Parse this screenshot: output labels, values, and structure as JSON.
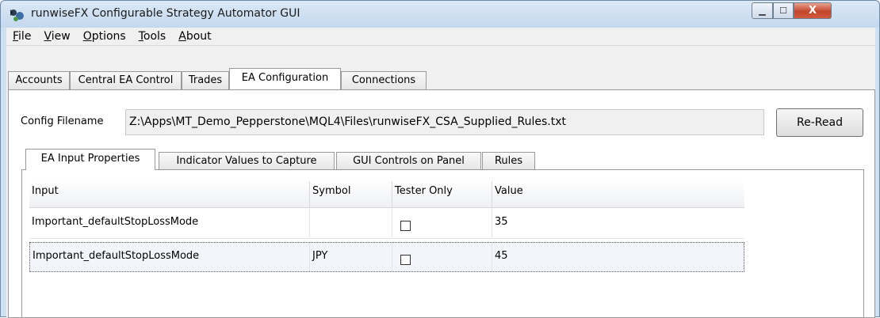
{
  "window": {
    "title": "runwiseFX Configurable Strategy Automator GUI",
    "controls": {
      "minimize": "▁",
      "maximize": "☐",
      "close": "X"
    }
  },
  "menu": [
    {
      "label": "File",
      "accel": "F",
      "rest": "ile"
    },
    {
      "label": "View",
      "accel": "V",
      "rest": "iew"
    },
    {
      "label": "Options",
      "accel": "O",
      "rest": "ptions"
    },
    {
      "label": "Tools",
      "accel": "T",
      "rest": "ools"
    },
    {
      "label": "About",
      "accel": "A",
      "rest": "bout"
    }
  ],
  "top_tabs": [
    {
      "label": "Accounts"
    },
    {
      "label": "Central EA Control"
    },
    {
      "label": "Trades"
    },
    {
      "label": "EA Configuration",
      "active": true
    },
    {
      "label": "Connections"
    }
  ],
  "config": {
    "label": "Config Filename",
    "value": "Z:\\Apps\\MT_Demo_Pepperstone\\MQL4\\Files\\runwiseFX_CSA_Supplied_Rules.txt",
    "reread_label": "Re-Read"
  },
  "inner_tabs": [
    {
      "label": "EA Input Properties",
      "active": true
    },
    {
      "label": "Indicator Values to Capture"
    },
    {
      "label": "GUI Controls on Panel"
    },
    {
      "label": "Rules"
    }
  ],
  "grid": {
    "columns": [
      "Input",
      "Symbol",
      "Tester Only",
      "Value"
    ],
    "rows": [
      {
        "input": "Important_defaultStopLossMode",
        "symbol": "",
        "tester_only": false,
        "value": "35"
      },
      {
        "input": "Important_defaultStopLossMode",
        "symbol": "JPY",
        "tester_only": false,
        "value": "45",
        "selected": true
      }
    ]
  },
  "colors": {
    "titlebar": "#c4d8ee",
    "close_button": "#c4452b",
    "selected_row": "#f2f6fb"
  }
}
